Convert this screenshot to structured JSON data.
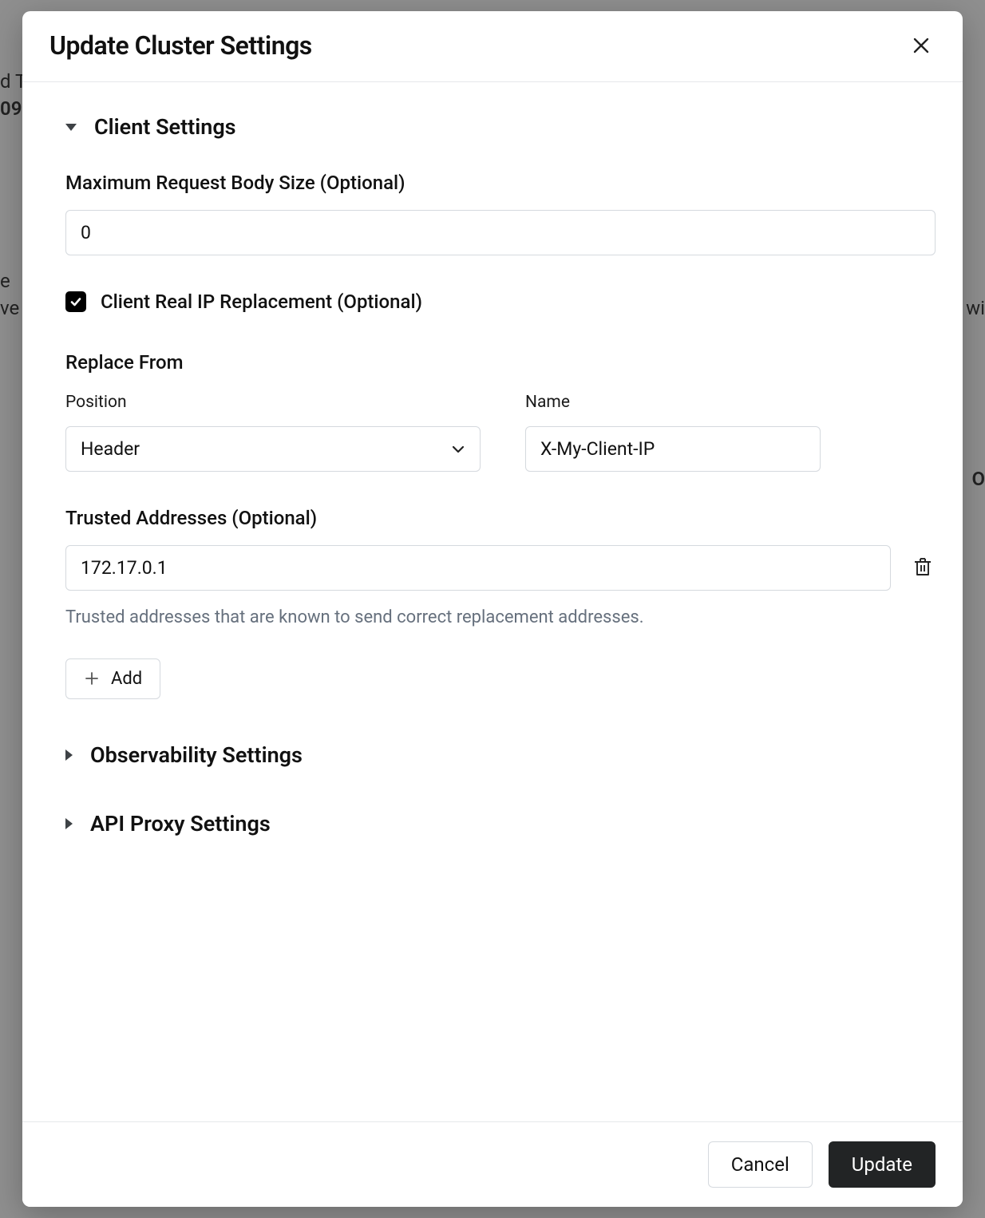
{
  "modal": {
    "title": "Update Cluster Settings"
  },
  "sections": {
    "client": {
      "title": "Client Settings",
      "max_body": {
        "label": "Maximum Request Body Size (Optional)",
        "value": "0"
      },
      "real_ip": {
        "label": "Client Real IP Replacement (Optional)",
        "checked": true
      },
      "replace_from": {
        "heading": "Replace From",
        "position_label": "Position",
        "position_value": "Header",
        "name_label": "Name",
        "name_value": "X-My-Client-IP"
      },
      "trusted": {
        "label": "Trusted Addresses (Optional)",
        "items": [
          "172.17.0.1"
        ],
        "help": "Trusted addresses that are known to send correct replacement addresses.",
        "add_label": "Add"
      }
    },
    "observability": {
      "title": "Observability Settings"
    },
    "proxy": {
      "title": "API Proxy Settings"
    }
  },
  "footer": {
    "cancel": "Cancel",
    "update": "Update"
  },
  "bg": {
    "t1": "d T",
    "t2": "09",
    "t3": "e",
    "t4": "ve",
    "t5": "wi",
    "t6": "O"
  }
}
